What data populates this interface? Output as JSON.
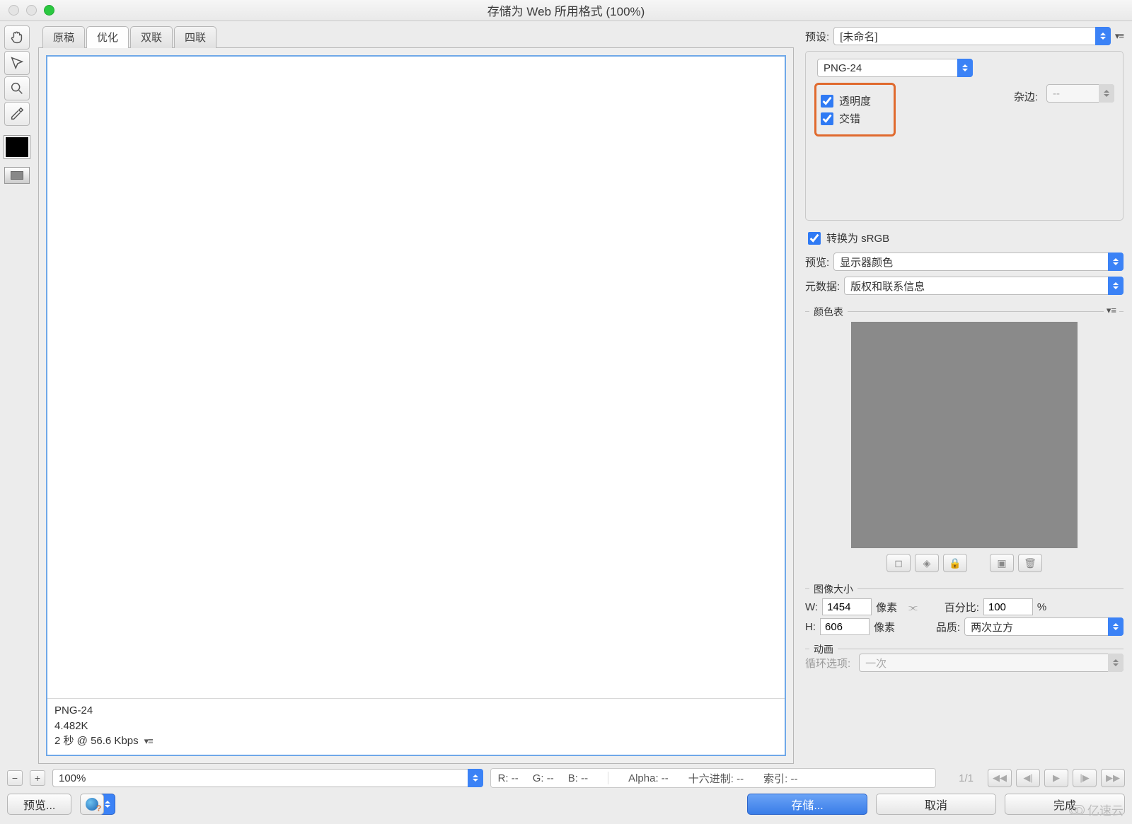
{
  "window": {
    "title": "存储为 Web 所用格式 (100%)"
  },
  "view_tabs": [
    "原稿",
    "优化",
    "双联",
    "四联"
  ],
  "view_tabs_active": 1,
  "canvas_info": {
    "format": "PNG-24",
    "size": "4.482K",
    "timing": "2 秒 @ 56.6 Kbps"
  },
  "preset": {
    "label": "预设:",
    "value": "[未命名]"
  },
  "format": {
    "value": "PNG-24"
  },
  "checkboxes": {
    "transparency": "透明度",
    "interlaced": "交错"
  },
  "matte": {
    "label": "杂边:",
    "value": "--"
  },
  "convert_srgb": "转换为 sRGB",
  "preview": {
    "label": "预览:",
    "value": "显示器颜色"
  },
  "metadata": {
    "label": "元数据:",
    "value": "版权和联系信息"
  },
  "color_table": {
    "label": "颜色表"
  },
  "image_size": {
    "label": "图像大小",
    "w_label": "W:",
    "w_value": "1454",
    "w_unit": "像素",
    "h_label": "H:",
    "h_value": "606",
    "h_unit": "像素",
    "pct_label": "百分比:",
    "pct_value": "100",
    "pct_unit": "%",
    "quality_label": "品质:",
    "quality_value": "两次立方"
  },
  "animation": {
    "label": "动画",
    "loop_label": "循环选项:",
    "loop_value": "一次",
    "frame": "1/1"
  },
  "status": {
    "zoom": "100%",
    "r": "R: --",
    "g": "G: --",
    "b": "B: --",
    "alpha": "Alpha: --",
    "hex": "十六进制: --",
    "index": "索引: --"
  },
  "buttons": {
    "preview": "预览...",
    "save": "存储...",
    "cancel": "取消",
    "done": "完成"
  },
  "watermark": "亿速云"
}
